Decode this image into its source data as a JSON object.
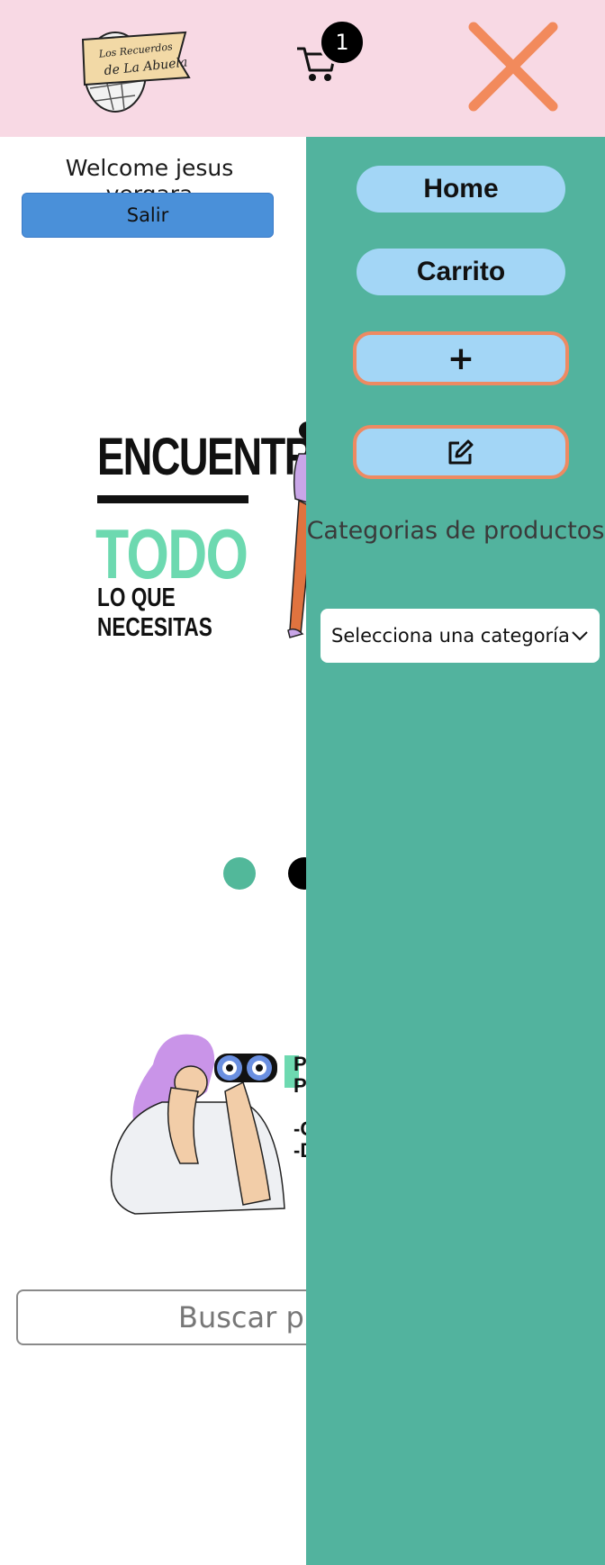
{
  "header": {
    "logo_text_line1": "Los Recuerdos",
    "logo_text_line2": "de La Abuela",
    "cart_count": "1"
  },
  "user": {
    "welcome": "Welcome jesus vergara",
    "logout_label": "Salir"
  },
  "banner1": {
    "title": "ENCUENTRA",
    "highlight": "TODO",
    "subtitle_line1": "LO QUE",
    "subtitle_line2": "NECESITAS"
  },
  "banner2": {
    "lines": [
      "P",
      "P",
      "",
      "-C",
      "-D"
    ]
  },
  "search": {
    "placeholder": "Buscar pr"
  },
  "menu": {
    "home_label": "Home",
    "cart_label": "Carrito",
    "add_label": "+",
    "categories_title": "Categorias de productos",
    "category_select_value": "Selecciona una categoría"
  },
  "colors": {
    "header_bg": "#f8d9e4",
    "panel_bg": "#52b39e",
    "nav_button_bg": "#a3d6f6",
    "accent_orange": "#ee8a62",
    "logout_bg": "#4a90d9",
    "highlight_green": "#6dd9b0"
  }
}
